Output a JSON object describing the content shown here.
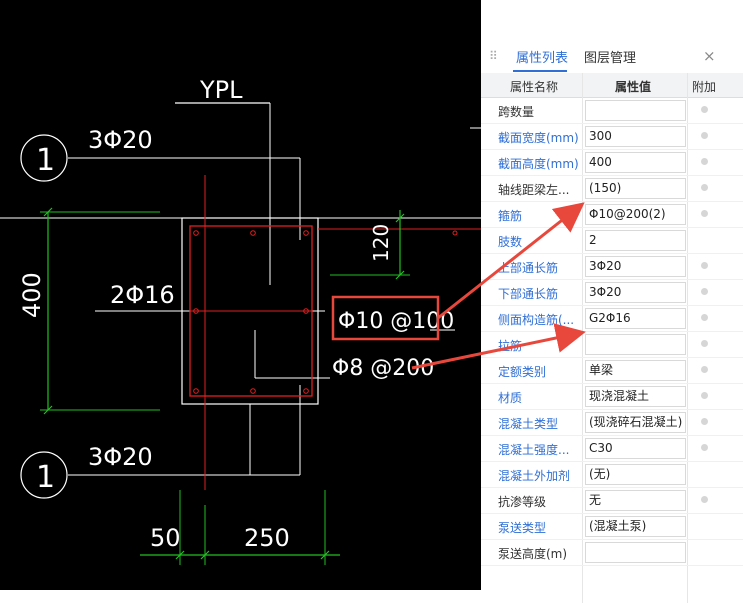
{
  "drawing": {
    "beam_label": "YPL",
    "axis_label_top": "1",
    "axis_label_bottom": "1",
    "top_rebar": "3Φ20",
    "bottom_rebar": "3Φ20",
    "side_rebar": "2Φ16",
    "stirrup_highlight": "Φ10 @100",
    "stirrup_plain": "Φ8 @200",
    "dim_height": "400",
    "dim_offset": "120",
    "dim_left": "50",
    "dim_width": "250"
  },
  "panel": {
    "tabs": [
      {
        "label": "属性列表"
      },
      {
        "label": "图层管理"
      }
    ],
    "close_glyph": "×",
    "drag_glyph": "⠿",
    "columns": {
      "name": "属性名称",
      "value": "属性值",
      "extra": "附加"
    },
    "rows": [
      {
        "name": "跨数量",
        "value": "",
        "dot": true
      },
      {
        "name": "截面宽度(mm)",
        "value": "300",
        "dot": true
      },
      {
        "name": "截面高度(mm)",
        "value": "400",
        "dot": true
      },
      {
        "name": "轴线距梁左...",
        "value": "(150)",
        "dot": true
      },
      {
        "name": "箍筋",
        "value": "Φ10@200(2)",
        "dot": true
      },
      {
        "name": "肢数",
        "value": "2",
        "dot": false
      },
      {
        "name": "上部通长筋",
        "value": "3Φ20",
        "dot": true
      },
      {
        "name": "下部通长筋",
        "value": "3Φ20",
        "dot": true
      },
      {
        "name": "侧面构造筋(...",
        "value": "G2Φ16",
        "dot": true
      },
      {
        "name": "拉筋",
        "value": "",
        "dot": true
      },
      {
        "name": "定额类别",
        "value": "单梁",
        "dot": true
      },
      {
        "name": "材质",
        "value": "现浇混凝土",
        "dot": true
      },
      {
        "name": "混凝土类型",
        "value": "(现浇碎石混凝土)",
        "dot": true
      },
      {
        "name": "混凝土强度...",
        "value": "C30",
        "dot": true
      },
      {
        "name": "混凝土外加剂",
        "value": "(无)",
        "dot": false
      },
      {
        "name": "抗渗等级",
        "value": "无",
        "dot": true
      },
      {
        "name": "泵送类型",
        "value": "(混凝土泵)",
        "dot": false
      },
      {
        "name": "泵送高度(m)",
        "value": "",
        "dot": false
      }
    ]
  },
  "colors": {
    "cad_background": "#000000",
    "rebar_red": "#e02020",
    "dimension_green": "#22c022",
    "arrow_red": "#e8473c",
    "link_blue": "#2f6fd6"
  }
}
